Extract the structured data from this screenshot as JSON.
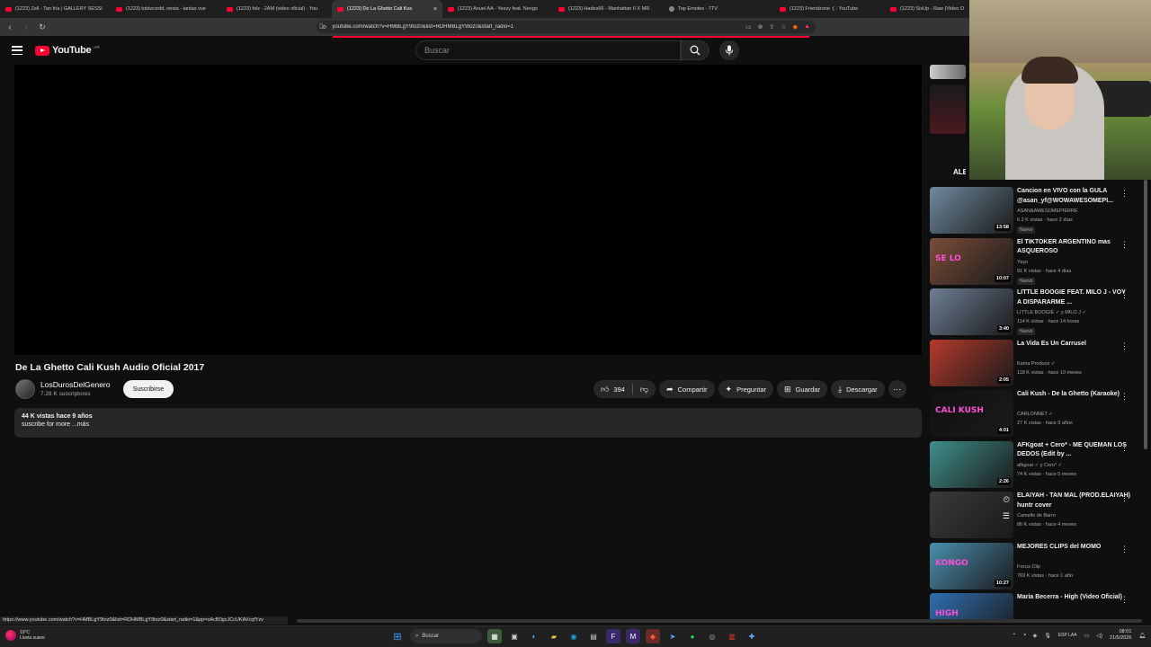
{
  "browser": {
    "tabs": [
      {
        "label": "(1223) Zell - Tan fría | GALLERY SESSI",
        "favicon": "youtube",
        "active": false
      },
      {
        "label": "(1223) tobiwcedd, nesta - tantas vue",
        "favicon": "youtube",
        "active": false
      },
      {
        "label": "(1223) felz - 2AM (video oficial) - You",
        "favicon": "youtube",
        "active": false
      },
      {
        "label": "(1223) De La Ghetto Cali Kus",
        "favicon": "youtube",
        "active": true
      },
      {
        "label": "(1223) Anuel AA - Yeezy feat. Ñengo",
        "favicon": "youtube",
        "active": false
      },
      {
        "label": "(1223) Hades66 - Manhattan II X MR",
        "favicon": "youtube",
        "active": false
      },
      {
        "label": "Top Emotes - 7TV",
        "favicon": "generic",
        "active": false
      },
      {
        "label": "(1223) Friendzone :( - YouTube",
        "favicon": "youtube",
        "active": false
      },
      {
        "label": "(1223) SixUp - Raw (Video O",
        "favicon": "youtube",
        "active": false
      }
    ],
    "url": "youtube.com/watch?v=HMBLgY9toz0&list=RDHMBLgY9toz0&start_radio=1",
    "status_url": "https://www.youtube.com/watch?v=HMBLgY9toz0&list=RDHMBLgY9toz0&start_radio=1&pp=oAcB0gcJCcUKAVcqfYzv"
  },
  "youtube": {
    "logo_text": "YouTube",
    "country_code": "AR",
    "search_placeholder": "Buscar"
  },
  "video": {
    "title": "De La Ghetto Cali Kush Audio Oficial 2017",
    "channel": "LosDurosDelGenero",
    "subscribers": "7.28 K suscriptores",
    "subscribe_label": "Suscribirse",
    "likes": "394",
    "share_label": "Compartir",
    "ask_label": "Preguntar",
    "save_label": "Guardar",
    "download_label": "Descargar",
    "views_line": "44 K vistas  hace 9 años",
    "description": "suscribe for more ...más"
  },
  "sidebar": {
    "partial_label": "ALE",
    "items": [
      {
        "title": "Cancion en VIVO con la GULA @asan_yf@WOWAWESOMEPI...",
        "channel": "ASAN&AWESOMEPIERRE",
        "meta": "6.2 K vistas · hace 2 días",
        "badge": "Nuevo",
        "duration": "13:58",
        "thumb": "#6f8a9e"
      },
      {
        "title": "El TIKTOKER ARGENTINO mas ASQUEROSO",
        "channel": "Yayo",
        "meta": "91 K vistas · hace 4 días",
        "badge": "Nuevo",
        "duration": "10:07",
        "thumb": "#7a4d3a",
        "overlay": "SE LO"
      },
      {
        "title": "LITTLE BOOGIE FEAT. MILO J - VOY A DISPARARME ...",
        "channel": "LITTLE BOOGIE ✓ y MILO J ✓",
        "meta": "114 K vistas · hace 14 horas",
        "badge": "Nuevo",
        "duration": "3:40",
        "thumb": "#6e7f95"
      },
      {
        "title": "La Vida Es Un Carrusel",
        "channel": "Kama Produce ✓",
        "meta": "118 K vistas · hace 10 meses",
        "badge": "",
        "duration": "2:05",
        "thumb": "#b53a2c"
      },
      {
        "title": "Cali Kush - De la Ghetto (Karaoke)",
        "channel": "CARLONNET ✓",
        "meta": "27 K vistas · hace 9 años",
        "badge": "",
        "duration": "4:01",
        "thumb": "#111111",
        "overlay": "CALI KUSH"
      },
      {
        "title": "AFKgoat + Cero* - ME QUEMAN LOS DEDOS (Edit by ...",
        "channel": "afkgoat ✓ y Cero* ✓",
        "meta": "74 K vistas · hace 5 meses",
        "badge": "",
        "duration": "2:26",
        "thumb": "#3f8f8a"
      },
      {
        "title": "ELAIYAH - TAN MAL (PROD.ELAIYAH) huntr cover",
        "channel": "Camello de Barro",
        "meta": "86 K vistas · hace 4 meses",
        "badge": "",
        "duration": "",
        "thumb": "#3a3a3a"
      },
      {
        "title": "MEJORES CLIPS del MOMO",
        "channel": "Focus Clip",
        "meta": "769 K vistas · hace 1 año",
        "badge": "",
        "duration": "10:27",
        "thumb": "#4a8fb0",
        "overlay": "KONGO"
      },
      {
        "title": "Maria Becerra - High (Video Oficial)",
        "channel": "",
        "meta": "",
        "badge": "",
        "duration": "",
        "thumb": "#2f6fb0",
        "overlay": "HIGH"
      }
    ]
  },
  "taskbar": {
    "weather_temp": "19°C",
    "weather_desc": "Lluvia suave",
    "search_label": "Buscar",
    "lang": "ESP LAA",
    "time": "08:01",
    "date": "21/5/2026"
  },
  "colors": {
    "accent": "#ff0033",
    "background": "#0f0f0f"
  }
}
